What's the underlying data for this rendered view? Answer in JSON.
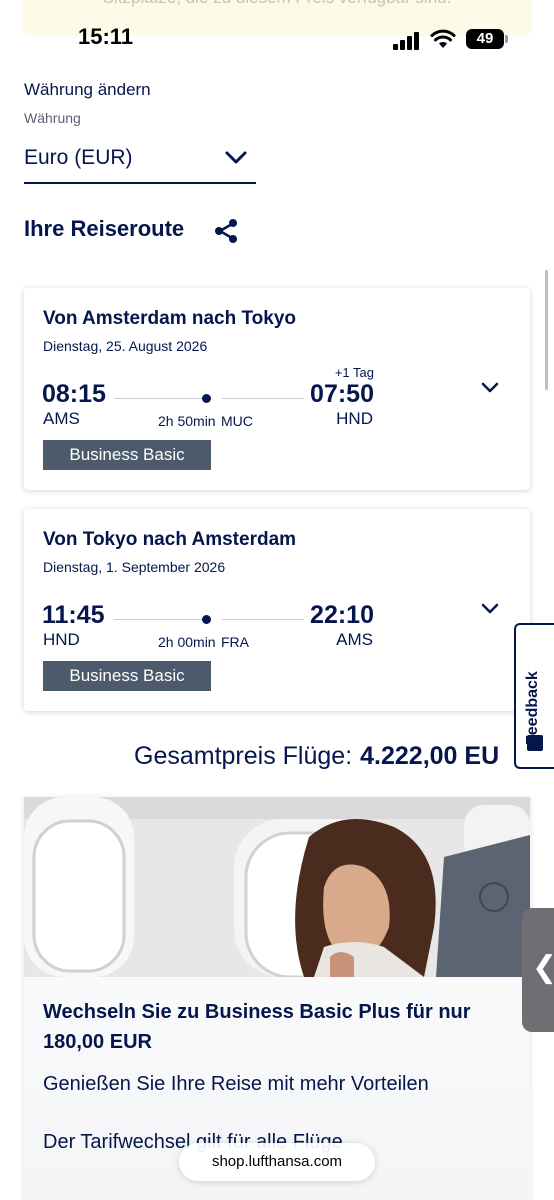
{
  "banner": {
    "text": "Sitzplätze, die zu diesem Preis verfügbar sind."
  },
  "status_bar": {
    "time": "15:11",
    "battery": "49"
  },
  "currency": {
    "title": "Währung ändern",
    "label": "Währung",
    "selected": "Euro (EUR)"
  },
  "itinerary": {
    "title": "Ihre Reiseroute",
    "flights": [
      {
        "title": "Von Amsterdam nach Tokyo",
        "date": "Dienstag, 25. August 2026",
        "dep_time": "08:15",
        "dep_code": "AMS",
        "arr_time": "07:50",
        "arr_code": "HND",
        "day_offset": "+1 Tag",
        "duration": "2h 50min",
        "stop": "MUC",
        "fare": "Business Basic"
      },
      {
        "title": "Von Tokyo nach Amsterdam",
        "date": "Dienstag, 1. September 2026",
        "dep_time": "11:45",
        "dep_code": "HND",
        "arr_time": "22:10",
        "arr_code": "AMS",
        "duration": "2h 00min",
        "stop": "FRA",
        "fare": "Business Basic"
      }
    ]
  },
  "total": {
    "label": "Gesamtpreis Flüge:",
    "value": "4.222,00 EU"
  },
  "feedback": {
    "label": "Feedback"
  },
  "promo": {
    "title": "Wechseln Sie zu Business Basic Plus für nur 180,00 EUR",
    "subtitle": "Genießen Sie Ihre Reise mit mehr Vorteilen",
    "note": "Der Tarifwechsel gilt für alle Flüge"
  },
  "side_handle": {
    "label": "❮"
  },
  "browser": {
    "url": "shop.lufthansa.com"
  }
}
